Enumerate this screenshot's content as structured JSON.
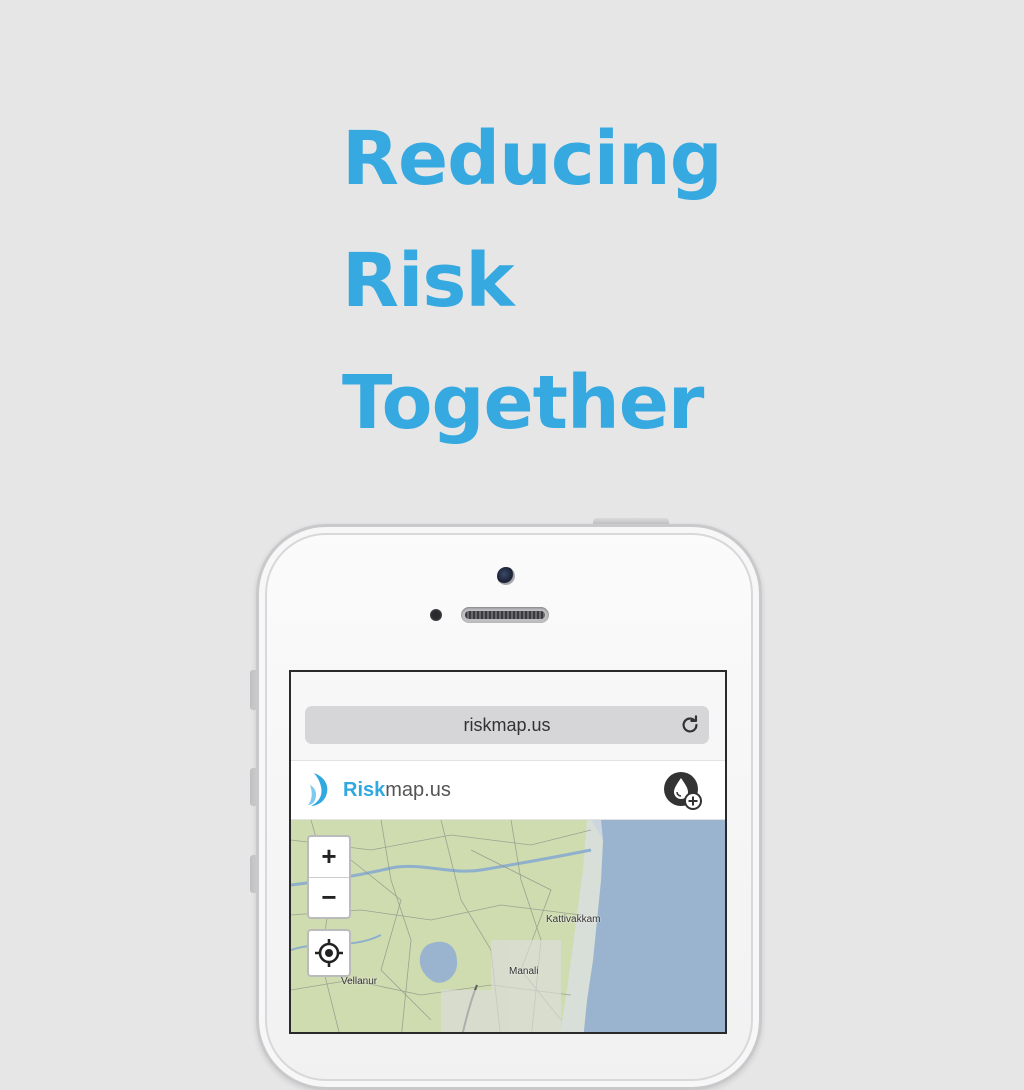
{
  "headline": {
    "line1": "Reducing",
    "line2": "Risk",
    "line3": "Together"
  },
  "browser": {
    "url": "riskmap.us"
  },
  "app": {
    "brand_bold": "Risk",
    "brand_rest": "map.us"
  },
  "map": {
    "zoom_in": "+",
    "zoom_out": "−",
    "labels": {
      "kattivakkam": "Kattivakkam",
      "manali": "Manali",
      "vellanur": "Vellanur"
    }
  },
  "colors": {
    "accent": "#35a9e0",
    "background": "#e6e6e7",
    "sea": "#9ab4cf",
    "land": "#cfdcb0"
  },
  "icons": [
    "reload-icon",
    "riskmap-logo-icon",
    "add-report-icon",
    "locate-icon"
  ]
}
